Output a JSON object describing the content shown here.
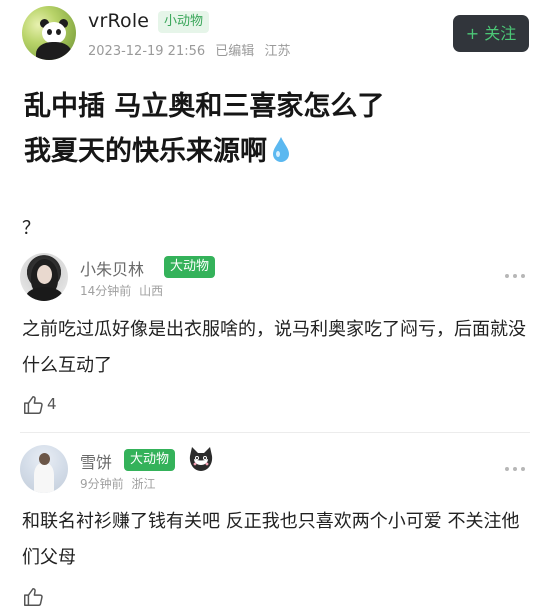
{
  "post": {
    "author": "vrRole",
    "author_badge": "小动物",
    "date": "2023-12-19 21:56",
    "edited": "已编辑",
    "location": "江苏",
    "follow_label": "+ 关注",
    "title_line1": "乱中插 马立奥和三喜家怎么了",
    "title_line2": "我夏天的快乐来源啊",
    "body": "？"
  },
  "comments": [
    {
      "name": "小朱贝林",
      "badge": "大动物",
      "time": "14分钟前",
      "location": "山西",
      "text": "之前吃过瓜好像是出衣服啥的，说马利奥家吃了闷亏，后面就没什么互动了",
      "likes": "4"
    },
    {
      "name": "雪饼",
      "badge": "大动物",
      "time": "9分钟前",
      "location": "浙江",
      "text": "和联名衬衫赚了钱有关吧 反正我也只喜欢两个小可爱 不关注他们父母",
      "likes": ""
    }
  ],
  "colors": {
    "accent_green": "#34b25a",
    "follow_bg": "#31353b",
    "follow_text": "#4cc777"
  },
  "icons": [
    "drop-icon",
    "more-icon",
    "like-icon",
    "cat-sticker-icon"
  ]
}
